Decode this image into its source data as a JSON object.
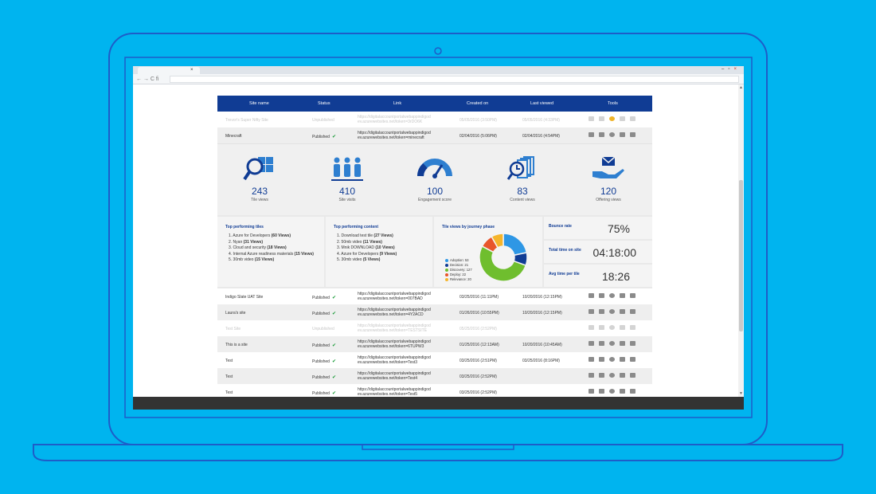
{
  "table": {
    "headers": {
      "site_name": "Site name",
      "status": "Status",
      "link": "Link",
      "created_on": "Created on",
      "last_viewed": "Last viewed",
      "tools": "Tools"
    },
    "top_rows": [
      {
        "name": "Trevor's Super Nifty Site",
        "status": "Unpublished",
        "link1": "https://digitalaccountportalwebappindigod",
        "link2": "ev.azurewebsites.net/token=3rDO6K",
        "created": "05/05/2016 (3:50PM)",
        "viewed": "05/05/2016 (4:33PM)"
      },
      {
        "name": "Minecraft",
        "status": "Published",
        "link1": "https://digitalaccountportalwebappindigod",
        "link2": "ev.azurewebsites.net/token=minecraft",
        "created": "02/04/2016 (5:06PM)",
        "viewed": "02/04/2016 (4:54PM)"
      }
    ],
    "bottom_rows": [
      {
        "name": "Indigo Slate UAT Site",
        "status": "Published",
        "link1": "https://digitalaccountportalwebappindigod",
        "link2": "ev.azurewebsites.net/token=007BAD",
        "created": "03/25/2016 (11:11PM)",
        "viewed": "10/20/2016 (12:15PM)"
      },
      {
        "name": "Laura's site",
        "status": "Published",
        "link1": "https://digitalaccountportalwebappindigod",
        "link2": "ev.azurewebsites.net/token=4Y2ACD",
        "created": "01/26/2016 (10:55PM)",
        "viewed": "10/20/2016 (12:15PM)"
      },
      {
        "name": "Test Site",
        "status": "Unpublished",
        "link1": "https://digitalaccountportalwebappindigod",
        "link2": "ev.azurewebsites.net/token=TESTSITE",
        "created": "05/25/2016 (2:52PM)",
        "viewed": ""
      },
      {
        "name": "This is a site",
        "status": "Published",
        "link1": "https://digitalaccountportalwebappindigod",
        "link2": "ev.azurewebsites.net/token=6TUPW3",
        "created": "01/25/2016 (12:13AM)",
        "viewed": "10/20/2016 (10:45AM)"
      },
      {
        "name": "Test",
        "status": "Published",
        "link1": "https://digitalaccountportalwebappindigod",
        "link2": "ev.azurewebsites.net/token=Test3",
        "created": "03/25/2016 (2:51PM)",
        "viewed": "03/25/2016 (8:16PM)"
      },
      {
        "name": "Test",
        "status": "Published",
        "link1": "https://digitalaccountportalwebappindigod",
        "link2": "ev.azurewebsites.net/token=Test4",
        "created": "03/25/2016 (2:52PM)",
        "viewed": ""
      },
      {
        "name": "Test",
        "status": "Published",
        "link1": "https://digitalaccountportalwebappindigod",
        "link2": "ev.azurewebsites.net/token=Test5",
        "created": "03/25/2016 (2:52PM)",
        "viewed": ""
      }
    ]
  },
  "stats": [
    {
      "value": "243",
      "label": "Tile views",
      "icon": "tile-search-icon"
    },
    {
      "value": "410",
      "label": "Site visits",
      "icon": "people-icon"
    },
    {
      "value": "100",
      "label": "Engagement score",
      "icon": "gauge-icon"
    },
    {
      "value": "83",
      "label": "Content views",
      "icon": "content-history-icon"
    },
    {
      "value": "120",
      "label": "Offering views",
      "icon": "hand-mail-icon"
    }
  ],
  "top_tiles": {
    "title": "Top performing tiles",
    "items": [
      [
        "1. Azure for Developers ",
        "(60 Views)"
      ],
      [
        "2. Nyan ",
        "(31 Views)"
      ],
      [
        "3. Cloud and security ",
        "(18 Views)"
      ],
      [
        "4. Internal Azure readiness materials ",
        "(15 Views)"
      ],
      [
        "5. 30mb video ",
        "(15 Views)"
      ]
    ]
  },
  "top_content": {
    "title": "Top performing content",
    "items": [
      [
        "1. Download test tile ",
        "(27 Views)"
      ],
      [
        "2. 50mb video ",
        "(11 Views)"
      ],
      [
        "3. Mnik DOWNLOAD ",
        "(10 Views)"
      ],
      [
        "4. Azure for Developers ",
        "(9 Views)"
      ],
      [
        "5. 30mb video ",
        "(5 Views)"
      ]
    ]
  },
  "chart_data": {
    "type": "pie",
    "title": "Tile views by journey phase",
    "categories": [
      "Adoption",
      "Decision",
      "Discovery",
      "Deploy",
      "Relevance"
    ],
    "values": [
      53,
      21,
      127,
      22,
      20
    ],
    "colors": [
      "#2e97e5",
      "#103c94",
      "#6fbe2e",
      "#e8552a",
      "#f5b52c"
    ]
  },
  "kpis": [
    {
      "label": "Bounce rate",
      "value": "75%"
    },
    {
      "label": "Total time on site",
      "value": "04:18:00"
    },
    {
      "label": "Avg time per tile",
      "value": "18:26"
    }
  ],
  "browser": {
    "tab_close": "×",
    "nav": "← → C fi"
  }
}
